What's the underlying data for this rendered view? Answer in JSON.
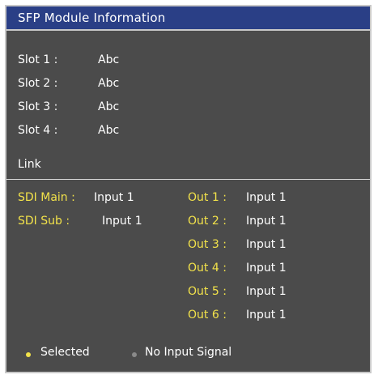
{
  "window": {
    "title": "SFP Module Information"
  },
  "slots": [
    {
      "label": "Slot 1 :",
      "value": "Abc"
    },
    {
      "label": "Slot 2 :",
      "value": "Abc"
    },
    {
      "label": "Slot 3 :",
      "value": "Abc"
    },
    {
      "label": "Slot 4 :",
      "value": "Abc"
    }
  ],
  "link": {
    "heading": "Link",
    "sdi": [
      {
        "label": "SDI Main :",
        "value": "Input 1"
      },
      {
        "label": "SDI Sub :",
        "value": "Input 1"
      }
    ],
    "outs": [
      {
        "label": "Out 1 :",
        "value": "Input 1"
      },
      {
        "label": "Out 2 :",
        "value": "Input 1"
      },
      {
        "label": "Out 3 :",
        "value": "Input 1"
      },
      {
        "label": "Out 4 :",
        "value": "Input 1"
      },
      {
        "label": "Out 5 :",
        "value": "Input 1"
      },
      {
        "label": "Out 6 :",
        "value": "Input 1"
      }
    ]
  },
  "legend": {
    "selected": {
      "label": "Selected",
      "color": "#f2e24a",
      "icon": "yellow-dot-icon"
    },
    "no_signal": {
      "label": "No Input Signal",
      "color": "#8a8a8a",
      "icon": "gray-dot-icon"
    }
  },
  "colors": {
    "panel": "#4b4b4b",
    "titlebar": "#2a3f86",
    "label_yellow": "#f2e24a",
    "border": "#c8c8c8"
  }
}
